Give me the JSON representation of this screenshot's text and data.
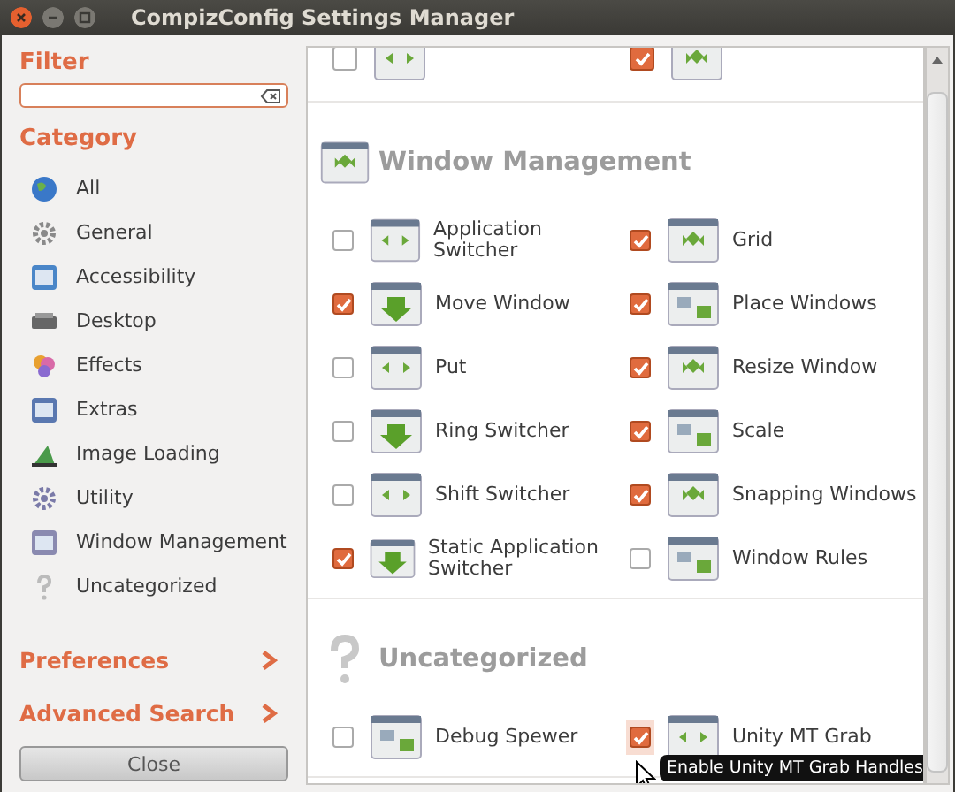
{
  "window": {
    "title": "CompizConfig Settings Manager"
  },
  "sidebar": {
    "filter_label": "Filter",
    "category_label": "Category",
    "categories": [
      {
        "label": "All"
      },
      {
        "label": "General"
      },
      {
        "label": "Accessibility"
      },
      {
        "label": "Desktop"
      },
      {
        "label": "Effects"
      },
      {
        "label": "Extras"
      },
      {
        "label": "Image Loading"
      },
      {
        "label": "Utility"
      },
      {
        "label": "Window Management"
      },
      {
        "label": "Uncategorized"
      }
    ],
    "links": [
      {
        "label": "Preferences"
      },
      {
        "label": "Advanced Search"
      }
    ],
    "close_button": "Close"
  },
  "top_partial_row": [
    {
      "checked": false
    },
    {
      "checked": true
    }
  ],
  "sections": [
    {
      "title": "Window Management",
      "plugins": [
        {
          "name": "Application Switcher",
          "enabled": false,
          "hovered": false
        },
        {
          "name": "Grid",
          "enabled": true,
          "hovered": false
        },
        {
          "name": "Move Window",
          "enabled": true,
          "hovered": false
        },
        {
          "name": "Place Windows",
          "enabled": true,
          "hovered": false
        },
        {
          "name": "Put",
          "enabled": false,
          "hovered": false
        },
        {
          "name": "Resize Window",
          "enabled": true,
          "hovered": false
        },
        {
          "name": "Ring Switcher",
          "enabled": false,
          "hovered": false
        },
        {
          "name": "Scale",
          "enabled": true,
          "hovered": false
        },
        {
          "name": "Shift Switcher",
          "enabled": false,
          "hovered": false
        },
        {
          "name": "Snapping Windows",
          "enabled": true,
          "hovered": false
        },
        {
          "name": "Static Application Switcher",
          "enabled": true,
          "hovered": false
        },
        {
          "name": "Window Rules",
          "enabled": false,
          "hovered": false
        }
      ]
    },
    {
      "title": "Uncategorized",
      "plugins": [
        {
          "name": "Debug Spewer",
          "enabled": false,
          "hovered": false
        },
        {
          "name": "Unity MT Grab",
          "enabled": true,
          "hovered": true
        }
      ]
    }
  ],
  "tooltip": {
    "text": "Enable Unity MT Grab Handles"
  }
}
